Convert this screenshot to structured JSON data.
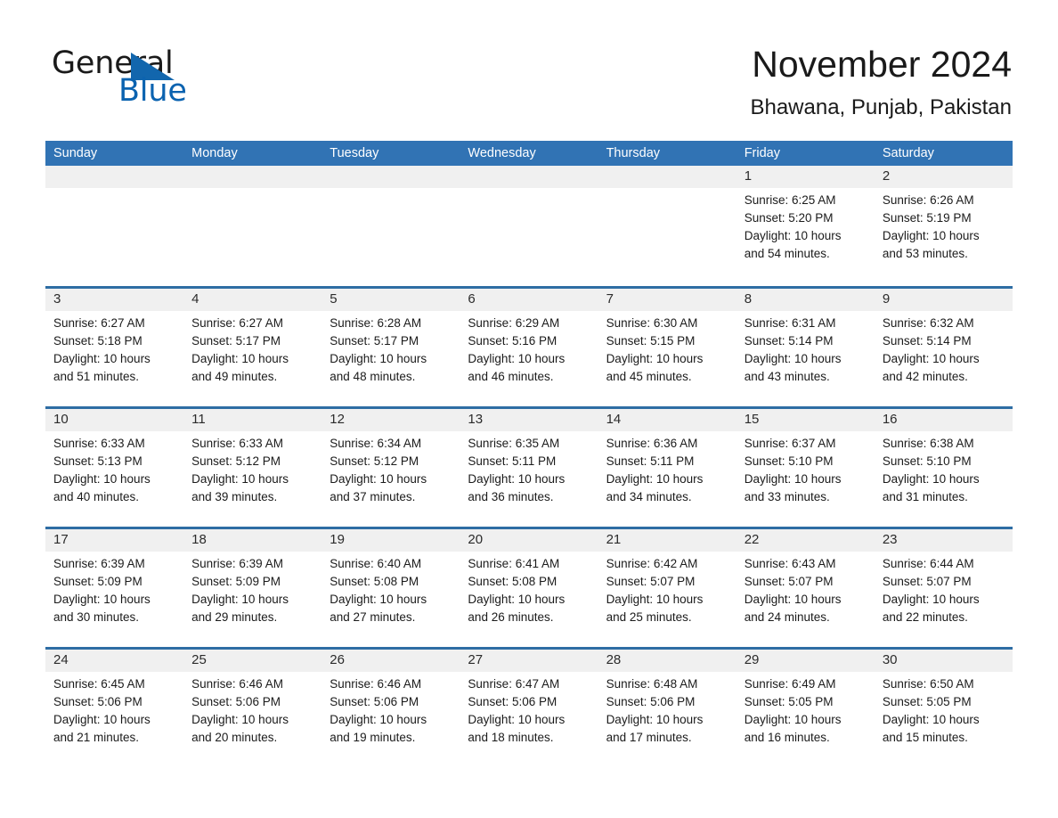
{
  "brand": {
    "name_part1": "General",
    "name_part2": "Blue",
    "accent_color": "#0b63b0",
    "triangle_color": "#1266ad"
  },
  "header": {
    "month_title": "November 2024",
    "location": "Bhawana, Punjab, Pakistan"
  },
  "theme": {
    "header_blue": "#3173b4",
    "row_divider_blue": "#2e6da4",
    "date_band_gray": "#f0f0f0"
  },
  "calendar": {
    "weekday_headers": [
      "Sunday",
      "Monday",
      "Tuesday",
      "Wednesday",
      "Thursday",
      "Friday",
      "Saturday"
    ],
    "weeks": [
      [
        {
          "day": "",
          "sunrise": "",
          "sunset": "",
          "daylight_line1": "",
          "daylight_line2": ""
        },
        {
          "day": "",
          "sunrise": "",
          "sunset": "",
          "daylight_line1": "",
          "daylight_line2": ""
        },
        {
          "day": "",
          "sunrise": "",
          "sunset": "",
          "daylight_line1": "",
          "daylight_line2": ""
        },
        {
          "day": "",
          "sunrise": "",
          "sunset": "",
          "daylight_line1": "",
          "daylight_line2": ""
        },
        {
          "day": "",
          "sunrise": "",
          "sunset": "",
          "daylight_line1": "",
          "daylight_line2": ""
        },
        {
          "day": "1",
          "sunrise": "Sunrise: 6:25 AM",
          "sunset": "Sunset: 5:20 PM",
          "daylight_line1": "Daylight: 10 hours",
          "daylight_line2": "and 54 minutes."
        },
        {
          "day": "2",
          "sunrise": "Sunrise: 6:26 AM",
          "sunset": "Sunset: 5:19 PM",
          "daylight_line1": "Daylight: 10 hours",
          "daylight_line2": "and 53 minutes."
        }
      ],
      [
        {
          "day": "3",
          "sunrise": "Sunrise: 6:27 AM",
          "sunset": "Sunset: 5:18 PM",
          "daylight_line1": "Daylight: 10 hours",
          "daylight_line2": "and 51 minutes."
        },
        {
          "day": "4",
          "sunrise": "Sunrise: 6:27 AM",
          "sunset": "Sunset: 5:17 PM",
          "daylight_line1": "Daylight: 10 hours",
          "daylight_line2": "and 49 minutes."
        },
        {
          "day": "5",
          "sunrise": "Sunrise: 6:28 AM",
          "sunset": "Sunset: 5:17 PM",
          "daylight_line1": "Daylight: 10 hours",
          "daylight_line2": "and 48 minutes."
        },
        {
          "day": "6",
          "sunrise": "Sunrise: 6:29 AM",
          "sunset": "Sunset: 5:16 PM",
          "daylight_line1": "Daylight: 10 hours",
          "daylight_line2": "and 46 minutes."
        },
        {
          "day": "7",
          "sunrise": "Sunrise: 6:30 AM",
          "sunset": "Sunset: 5:15 PM",
          "daylight_line1": "Daylight: 10 hours",
          "daylight_line2": "and 45 minutes."
        },
        {
          "day": "8",
          "sunrise": "Sunrise: 6:31 AM",
          "sunset": "Sunset: 5:14 PM",
          "daylight_line1": "Daylight: 10 hours",
          "daylight_line2": "and 43 minutes."
        },
        {
          "day": "9",
          "sunrise": "Sunrise: 6:32 AM",
          "sunset": "Sunset: 5:14 PM",
          "daylight_line1": "Daylight: 10 hours",
          "daylight_line2": "and 42 minutes."
        }
      ],
      [
        {
          "day": "10",
          "sunrise": "Sunrise: 6:33 AM",
          "sunset": "Sunset: 5:13 PM",
          "daylight_line1": "Daylight: 10 hours",
          "daylight_line2": "and 40 minutes."
        },
        {
          "day": "11",
          "sunrise": "Sunrise: 6:33 AM",
          "sunset": "Sunset: 5:12 PM",
          "daylight_line1": "Daylight: 10 hours",
          "daylight_line2": "and 39 minutes."
        },
        {
          "day": "12",
          "sunrise": "Sunrise: 6:34 AM",
          "sunset": "Sunset: 5:12 PM",
          "daylight_line1": "Daylight: 10 hours",
          "daylight_line2": "and 37 minutes."
        },
        {
          "day": "13",
          "sunrise": "Sunrise: 6:35 AM",
          "sunset": "Sunset: 5:11 PM",
          "daylight_line1": "Daylight: 10 hours",
          "daylight_line2": "and 36 minutes."
        },
        {
          "day": "14",
          "sunrise": "Sunrise: 6:36 AM",
          "sunset": "Sunset: 5:11 PM",
          "daylight_line1": "Daylight: 10 hours",
          "daylight_line2": "and 34 minutes."
        },
        {
          "day": "15",
          "sunrise": "Sunrise: 6:37 AM",
          "sunset": "Sunset: 5:10 PM",
          "daylight_line1": "Daylight: 10 hours",
          "daylight_line2": "and 33 minutes."
        },
        {
          "day": "16",
          "sunrise": "Sunrise: 6:38 AM",
          "sunset": "Sunset: 5:10 PM",
          "daylight_line1": "Daylight: 10 hours",
          "daylight_line2": "and 31 minutes."
        }
      ],
      [
        {
          "day": "17",
          "sunrise": "Sunrise: 6:39 AM",
          "sunset": "Sunset: 5:09 PM",
          "daylight_line1": "Daylight: 10 hours",
          "daylight_line2": "and 30 minutes."
        },
        {
          "day": "18",
          "sunrise": "Sunrise: 6:39 AM",
          "sunset": "Sunset: 5:09 PM",
          "daylight_line1": "Daylight: 10 hours",
          "daylight_line2": "and 29 minutes."
        },
        {
          "day": "19",
          "sunrise": "Sunrise: 6:40 AM",
          "sunset": "Sunset: 5:08 PM",
          "daylight_line1": "Daylight: 10 hours",
          "daylight_line2": "and 27 minutes."
        },
        {
          "day": "20",
          "sunrise": "Sunrise: 6:41 AM",
          "sunset": "Sunset: 5:08 PM",
          "daylight_line1": "Daylight: 10 hours",
          "daylight_line2": "and 26 minutes."
        },
        {
          "day": "21",
          "sunrise": "Sunrise: 6:42 AM",
          "sunset": "Sunset: 5:07 PM",
          "daylight_line1": "Daylight: 10 hours",
          "daylight_line2": "and 25 minutes."
        },
        {
          "day": "22",
          "sunrise": "Sunrise: 6:43 AM",
          "sunset": "Sunset: 5:07 PM",
          "daylight_line1": "Daylight: 10 hours",
          "daylight_line2": "and 24 minutes."
        },
        {
          "day": "23",
          "sunrise": "Sunrise: 6:44 AM",
          "sunset": "Sunset: 5:07 PM",
          "daylight_line1": "Daylight: 10 hours",
          "daylight_line2": "and 22 minutes."
        }
      ],
      [
        {
          "day": "24",
          "sunrise": "Sunrise: 6:45 AM",
          "sunset": "Sunset: 5:06 PM",
          "daylight_line1": "Daylight: 10 hours",
          "daylight_line2": "and 21 minutes."
        },
        {
          "day": "25",
          "sunrise": "Sunrise: 6:46 AM",
          "sunset": "Sunset: 5:06 PM",
          "daylight_line1": "Daylight: 10 hours",
          "daylight_line2": "and 20 minutes."
        },
        {
          "day": "26",
          "sunrise": "Sunrise: 6:46 AM",
          "sunset": "Sunset: 5:06 PM",
          "daylight_line1": "Daylight: 10 hours",
          "daylight_line2": "and 19 minutes."
        },
        {
          "day": "27",
          "sunrise": "Sunrise: 6:47 AM",
          "sunset": "Sunset: 5:06 PM",
          "daylight_line1": "Daylight: 10 hours",
          "daylight_line2": "and 18 minutes."
        },
        {
          "day": "28",
          "sunrise": "Sunrise: 6:48 AM",
          "sunset": "Sunset: 5:06 PM",
          "daylight_line1": "Daylight: 10 hours",
          "daylight_line2": "and 17 minutes."
        },
        {
          "day": "29",
          "sunrise": "Sunrise: 6:49 AM",
          "sunset": "Sunset: 5:05 PM",
          "daylight_line1": "Daylight: 10 hours",
          "daylight_line2": "and 16 minutes."
        },
        {
          "day": "30",
          "sunrise": "Sunrise: 6:50 AM",
          "sunset": "Sunset: 5:05 PM",
          "daylight_line1": "Daylight: 10 hours",
          "daylight_line2": "and 15 minutes."
        }
      ]
    ]
  }
}
